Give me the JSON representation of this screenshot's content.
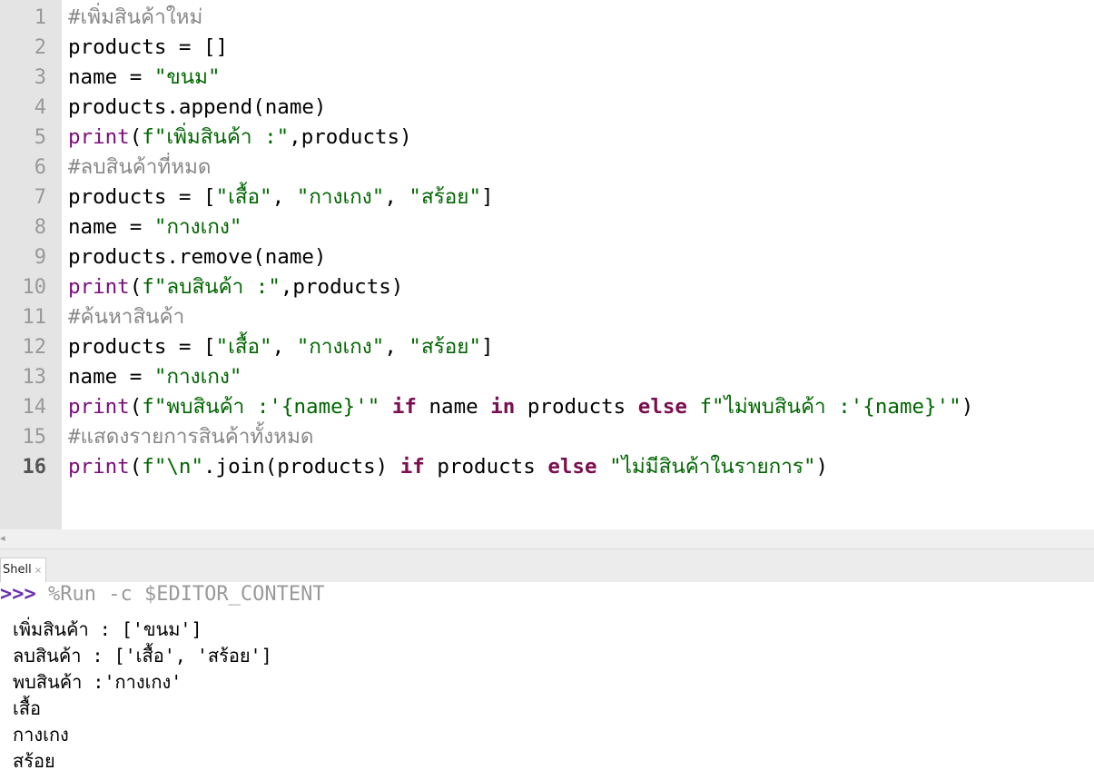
{
  "editor": {
    "line_numbers": [
      "1",
      "2",
      "3",
      "4",
      "5",
      "6",
      "7",
      "8",
      "9",
      "10",
      "11",
      "12",
      "13",
      "14",
      "15",
      "16"
    ],
    "current_line": 16,
    "lines": [
      [
        {
          "t": "#เพิ่มสินค้าใหม่",
          "c": "cm"
        }
      ],
      [
        {
          "t": "products = []",
          "c": "pl"
        }
      ],
      [
        {
          "t": "name = ",
          "c": "pl"
        },
        {
          "t": "\"ขนม\"",
          "c": "str"
        }
      ],
      [
        {
          "t": "products.append(name)",
          "c": "pl"
        }
      ],
      [
        {
          "t": "print",
          "c": "bi"
        },
        {
          "t": "(",
          "c": "pl"
        },
        {
          "t": "f\"เพิ่มสินค้า :\"",
          "c": "str"
        },
        {
          "t": ",products)",
          "c": "pl"
        }
      ],
      [
        {
          "t": "#ลบสินค้าที่หมด",
          "c": "cm"
        }
      ],
      [
        {
          "t": "products = [",
          "c": "pl"
        },
        {
          "t": "\"เสื้อ\"",
          "c": "str"
        },
        {
          "t": ", ",
          "c": "pl"
        },
        {
          "t": "\"กางเกง\"",
          "c": "str"
        },
        {
          "t": ", ",
          "c": "pl"
        },
        {
          "t": "\"สร้อย\"",
          "c": "str"
        },
        {
          "t": "]",
          "c": "pl"
        }
      ],
      [
        {
          "t": "name = ",
          "c": "pl"
        },
        {
          "t": "\"กางเกง\"",
          "c": "str"
        }
      ],
      [
        {
          "t": "products.remove(name)",
          "c": "pl"
        }
      ],
      [
        {
          "t": "print",
          "c": "bi"
        },
        {
          "t": "(",
          "c": "pl"
        },
        {
          "t": "f\"ลบสินค้า :\"",
          "c": "str"
        },
        {
          "t": ",products)",
          "c": "pl"
        }
      ],
      [
        {
          "t": "#ค้นหาสินค้า",
          "c": "cm"
        }
      ],
      [
        {
          "t": "products = [",
          "c": "pl"
        },
        {
          "t": "\"เสื้อ\"",
          "c": "str"
        },
        {
          "t": ", ",
          "c": "pl"
        },
        {
          "t": "\"กางเกง\"",
          "c": "str"
        },
        {
          "t": ", ",
          "c": "pl"
        },
        {
          "t": "\"สร้อย\"",
          "c": "str"
        },
        {
          "t": "]",
          "c": "pl"
        }
      ],
      [
        {
          "t": "name = ",
          "c": "pl"
        },
        {
          "t": "\"กางเกง\"",
          "c": "str"
        }
      ],
      [
        {
          "t": "print",
          "c": "bi"
        },
        {
          "t": "(",
          "c": "pl"
        },
        {
          "t": "f\"พบสินค้า :'{name}'\"",
          "c": "str"
        },
        {
          "t": " ",
          "c": "pl"
        },
        {
          "t": "if",
          "c": "kw"
        },
        {
          "t": " name ",
          "c": "pl"
        },
        {
          "t": "in",
          "c": "kw"
        },
        {
          "t": " products ",
          "c": "pl"
        },
        {
          "t": "else",
          "c": "kw"
        },
        {
          "t": " ",
          "c": "pl"
        },
        {
          "t": "f\"ไม่พบสินค้า :'{name}'\"",
          "c": "str"
        },
        {
          "t": ")",
          "c": "pl"
        }
      ],
      [
        {
          "t": "#แสดงรายการสินค้าทั้งหมด",
          "c": "cm"
        }
      ],
      [
        {
          "t": "print",
          "c": "bi"
        },
        {
          "t": "(",
          "c": "pl"
        },
        {
          "t": "f\"\\n\"",
          "c": "str"
        },
        {
          "t": ".join(products) ",
          "c": "pl"
        },
        {
          "t": "if",
          "c": "kw"
        },
        {
          "t": " products ",
          "c": "pl"
        },
        {
          "t": "else",
          "c": "kw"
        },
        {
          "t": " ",
          "c": "pl"
        },
        {
          "t": "\"ไม่มีสินค้าในรายการ\"",
          "c": "str"
        },
        {
          "t": ")",
          "c": "pl"
        }
      ]
    ]
  },
  "shell": {
    "tab_label": "Shell",
    "tab_close": "×",
    "prompt": ">>>",
    "command": " %Run -c $EDITOR_CONTENT",
    "output": [
      "เพิ่มสินค้า : ['ขนม']",
      "ลบสินค้า : ['เสื้อ', 'สร้อย']",
      "พบสินค้า :'กางเกง'",
      "เสื้อ",
      "กางเกง",
      "สร้อย"
    ]
  },
  "colors": {
    "comment": "#888888",
    "string": "#006600",
    "builtin": "#7a0e7a",
    "keyword": "#7a0e4e",
    "gutter": "#e4e4e4",
    "prompt": "#6a2fb0"
  },
  "icons": {
    "scroll_left": "◂"
  }
}
